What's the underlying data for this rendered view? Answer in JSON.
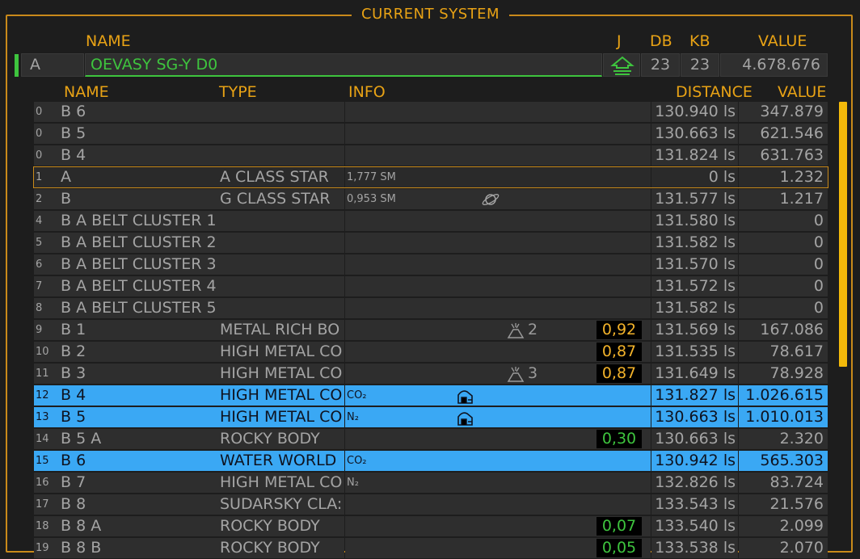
{
  "frame_title": "CURRENT SYSTEM",
  "sys_headers": {
    "name": "NAME",
    "j": "J",
    "db": "DB",
    "kb": "KB",
    "value": "VALUE"
  },
  "system": {
    "letter": "A",
    "name": "OEVASY SG-Y D0",
    "db": "23",
    "kb": "23",
    "value": "4.678.676",
    "jump_icon": "jump-up-icon"
  },
  "body_headers": {
    "name": "NAME",
    "type": "TYPE",
    "info": "INFO",
    "distance": "DISTANCE",
    "value": "VALUE"
  },
  "rows": [
    {
      "num": "0",
      "name": "B 6",
      "type": "",
      "info": "",
      "dist": "130.940 ls",
      "value": "347.879"
    },
    {
      "num": "0",
      "name": "B 5",
      "type": "",
      "info": "",
      "dist": "130.663 ls",
      "value": "621.546"
    },
    {
      "num": "0",
      "name": "B 4",
      "type": "",
      "info": "",
      "dist": "131.824 ls",
      "value": "631.763"
    },
    {
      "num": "1",
      "name": "A",
      "type": "A CLASS STAR",
      "info": "1,777 SM",
      "dist": "0 ls",
      "value": "1.232"
    },
    {
      "num": "2",
      "name": "B",
      "type": "G CLASS STAR",
      "info": "0,953 SM",
      "dist": "131.577 ls",
      "value": "1.217"
    },
    {
      "num": "4",
      "name": "B A BELT CLUSTER 1",
      "type": "",
      "info": "",
      "dist": "131.580 ls",
      "value": "0"
    },
    {
      "num": "5",
      "name": "B A BELT CLUSTER 2",
      "type": "",
      "info": "",
      "dist": "131.582 ls",
      "value": "0"
    },
    {
      "num": "6",
      "name": "B A BELT CLUSTER 3",
      "type": "",
      "info": "",
      "dist": "131.570 ls",
      "value": "0"
    },
    {
      "num": "7",
      "name": "B A BELT CLUSTER 4",
      "type": "",
      "info": "",
      "dist": "131.572 ls",
      "value": "0"
    },
    {
      "num": "8",
      "name": "B A BELT CLUSTER 5",
      "type": "",
      "info": "",
      "dist": "131.582 ls",
      "value": "0"
    },
    {
      "num": "9",
      "name": "B 1",
      "type": "METAL RICH BO",
      "info": "",
      "geo": "2",
      "terra": "0,92",
      "dist": "131.569 ls",
      "value": "167.086"
    },
    {
      "num": "10",
      "name": "B 2",
      "type": "HIGH METAL CO",
      "info": "",
      "terra": "0,87",
      "dist": "131.535 ls",
      "value": "78.617"
    },
    {
      "num": "11",
      "name": "B 3",
      "type": "HIGH METAL CO",
      "info": "",
      "geo": "3",
      "terra": "0,87",
      "dist": "131.649 ls",
      "value": "78.928"
    },
    {
      "num": "12",
      "name": "B 4",
      "type": "HIGH METAL CO",
      "info": "CO₂",
      "dist": "131.827 ls",
      "value": "1.026.615"
    },
    {
      "num": "13",
      "name": "B 5",
      "type": "HIGH METAL CO",
      "info": "N₂",
      "dist": "130.663 ls",
      "value": "1.010.013"
    },
    {
      "num": "14",
      "name": "B 5 A",
      "type": "ROCKY BODY",
      "info": "",
      "terra": "0,30",
      "dist": "130.663 ls",
      "value": "2.320"
    },
    {
      "num": "15",
      "name": "B 6",
      "type": "WATER WORLD",
      "info": "CO₂",
      "dist": "130.942 ls",
      "value": "565.303"
    },
    {
      "num": "16",
      "name": "B 7",
      "type": "HIGH METAL CO",
      "info": "N₂",
      "dist": "132.826 ls",
      "value": "83.724"
    },
    {
      "num": "17",
      "name": "B 8",
      "type": "SUDARSKY CLA:",
      "info": "",
      "dist": "133.543 ls",
      "value": "21.576"
    },
    {
      "num": "18",
      "name": "B 8 A",
      "type": "ROCKY BODY",
      "info": "",
      "terra": "0,07",
      "dist": "133.540 ls",
      "value": "2.099"
    },
    {
      "num": "19",
      "name": "B 8 B",
      "type": "ROCKY BODY",
      "info": "",
      "terra": "0,05",
      "dist": "133.538 ls",
      "value": "2.070"
    }
  ],
  "colors": {
    "accent": "#e8a215",
    "highlight": "#3aa8f4",
    "green": "#3ec43e",
    "scrollbar": "#f2b90a"
  }
}
